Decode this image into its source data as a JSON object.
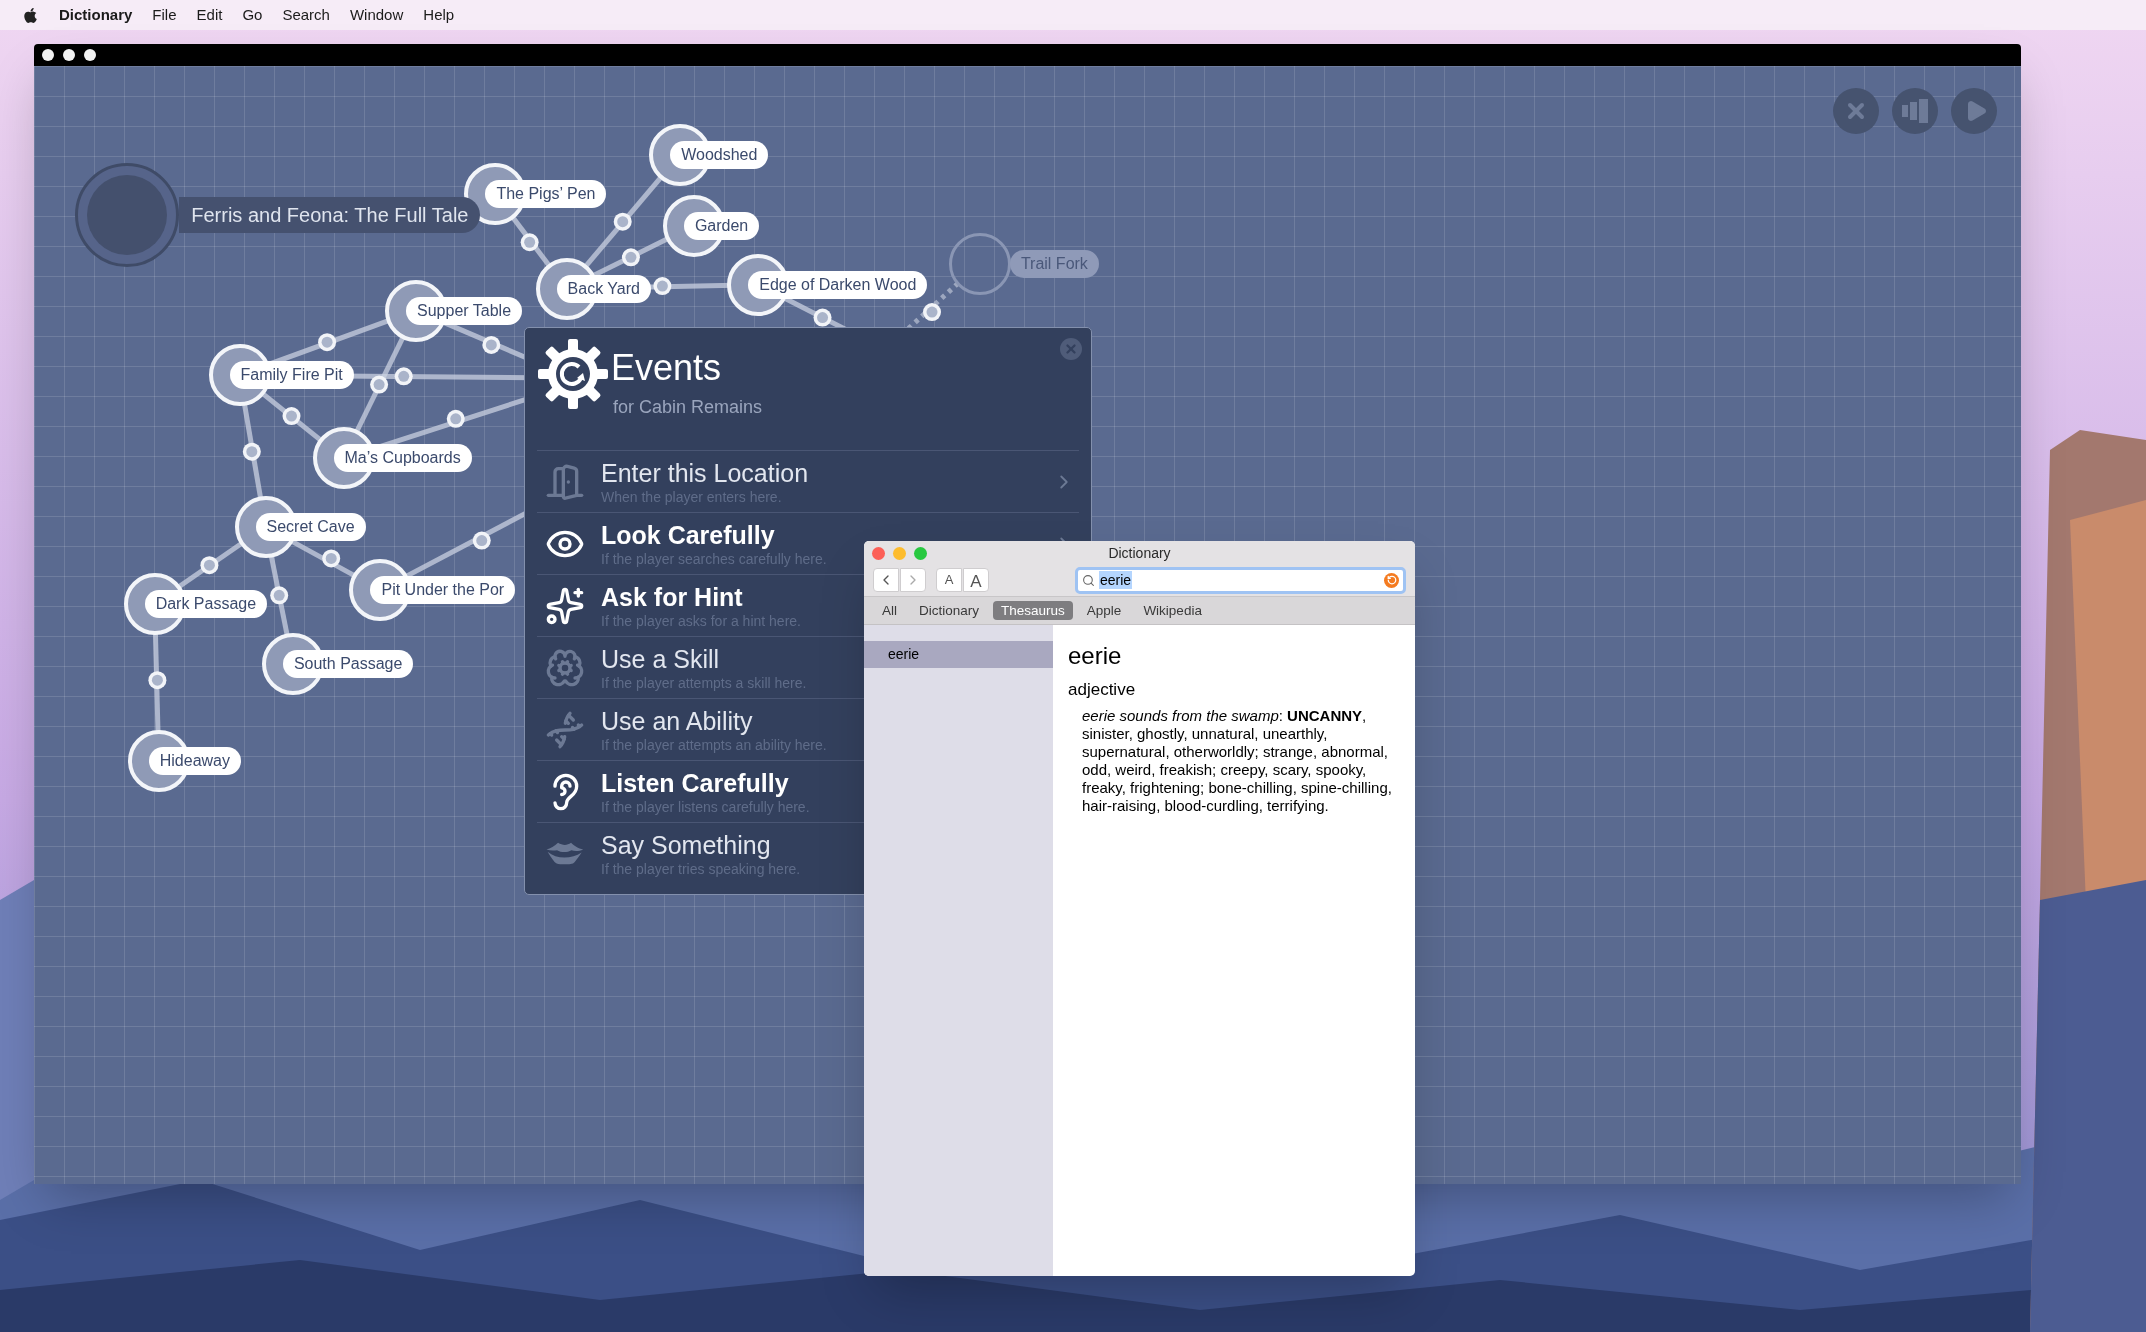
{
  "menu_bar": {
    "app_name": "Dictionary",
    "items": [
      "File",
      "Edit",
      "Go",
      "Search",
      "Window",
      "Help"
    ]
  },
  "map": {
    "story_title": "Ferris and Feona: The Full Tale",
    "locations": [
      {
        "label": "Woodshed",
        "faded": false
      },
      {
        "label": "The Pigs’ Pen",
        "faded": false
      },
      {
        "label": "Garden",
        "faded": false
      },
      {
        "label": "Back Yard",
        "faded": false
      },
      {
        "label": "Edge of Darken Wood",
        "faded": false
      },
      {
        "label": "Trail Fork",
        "faded": true
      },
      {
        "label": "Supper Table",
        "faded": false
      },
      {
        "label": "Family Fire Pit",
        "faded": false
      },
      {
        "label": "Ma’s Cupboards",
        "faded": false
      },
      {
        "label": "Secret Cave",
        "faded": false
      },
      {
        "label": "Dark Passage",
        "faded": false
      },
      {
        "label": "Pit Under the Por",
        "faded": false
      },
      {
        "label": "South Passage",
        "faded": false
      },
      {
        "label": "Hideaway",
        "faded": false
      }
    ]
  },
  "events_panel": {
    "title": "Events",
    "subtitle": "for Cabin Remains",
    "events": [
      {
        "title": "Enter this Location",
        "hint": "When the player enters here.",
        "highlighted": false
      },
      {
        "title": "Look Carefully",
        "hint": "If the player searches carefully here.",
        "highlighted": true
      },
      {
        "title": "Ask for Hint",
        "hint": "If the player asks for a hint here.",
        "highlighted": true
      },
      {
        "title": "Use a Skill",
        "hint": "If the player attempts a skill here.",
        "highlighted": false
      },
      {
        "title": "Use an Ability",
        "hint": "If the player attempts an ability here.",
        "highlighted": false
      },
      {
        "title": "Listen Carefully",
        "hint": "If the player listens carefully here.",
        "highlighted": true
      },
      {
        "title": "Say Something",
        "hint": "If the player tries speaking here.",
        "highlighted": false
      }
    ]
  },
  "dictionary_window": {
    "title": "Dictionary",
    "font_buttons": [
      "A",
      "A"
    ],
    "search": {
      "value": "eerie",
      "text_selected": true
    },
    "sources": [
      {
        "label": "All",
        "selected": false
      },
      {
        "label": "Dictionary",
        "selected": false
      },
      {
        "label": "Thesaurus",
        "selected": true
      },
      {
        "label": "Apple",
        "selected": false
      },
      {
        "label": "Wikipedia",
        "selected": false
      }
    ],
    "sidebar": [
      {
        "label": "eerie",
        "selected": true
      }
    ],
    "entry": {
      "headword": "eerie",
      "part_of_speech": "adjective",
      "definition": "*eerie sounds from the swamp*: **UNCANNY**, sinister, ghostly, unnatural, unearthly, supernatural, otherworldly; strange, abnormal, odd, weird, freakish; creepy, scary, spooky, freaky, frightening; bone-chilling, spine-chilling, hair-raising, blood-curdling, terrifying."
    }
  }
}
